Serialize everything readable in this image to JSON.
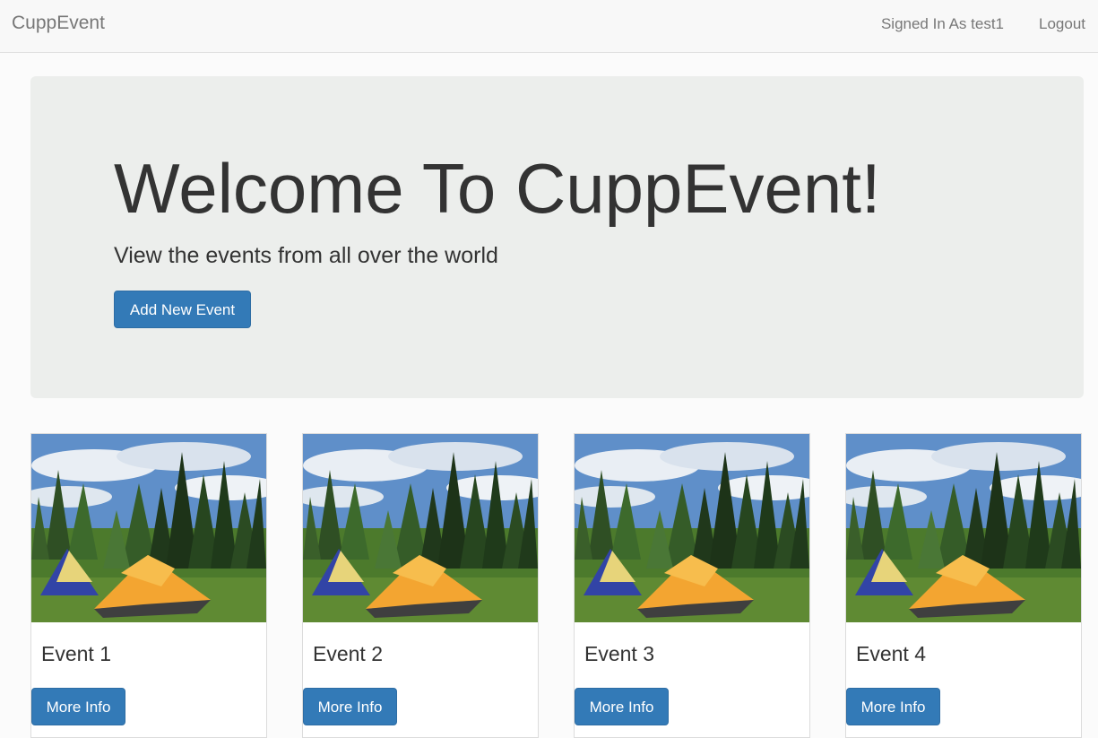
{
  "navbar": {
    "brand": "CuppEvent",
    "signed_in": "Signed In As test1",
    "logout": "Logout"
  },
  "jumbotron": {
    "title": "Welcome To CuppEvent!",
    "subtitle": "View the events from all over the world",
    "add_button": "Add New Event"
  },
  "events": [
    {
      "title": "Event 1",
      "button": "More Info"
    },
    {
      "title": "Event 2",
      "button": "More Info"
    },
    {
      "title": "Event 3",
      "button": "More Info"
    },
    {
      "title": "Event 4",
      "button": "More Info"
    }
  ],
  "colors": {
    "primary": "#337ab7",
    "jumbotron_bg": "#eceeec",
    "navbar_bg": "#f8f8f8"
  }
}
